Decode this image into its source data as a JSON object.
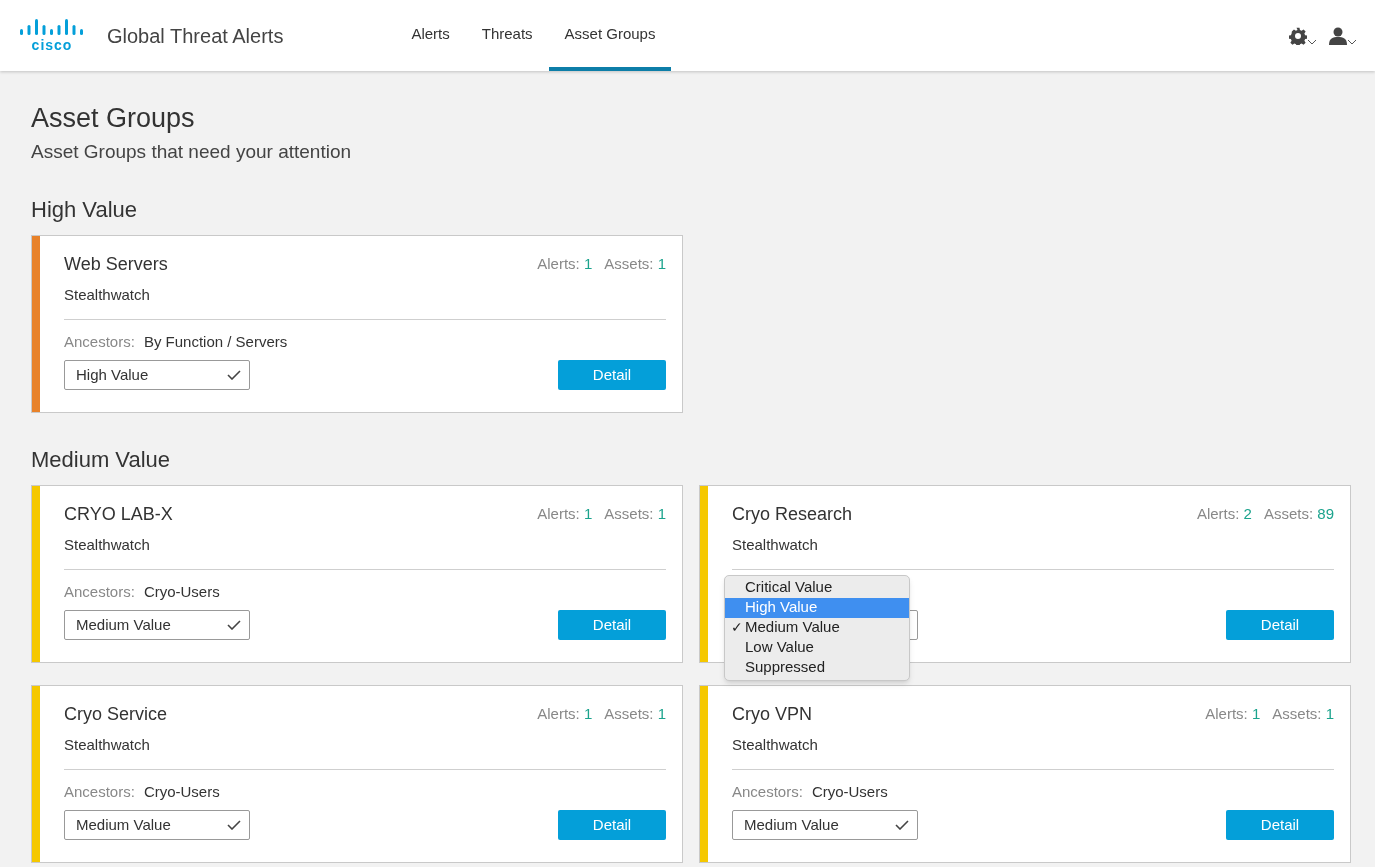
{
  "header": {
    "logo_text": "cisco",
    "app_title": "Global Threat Alerts",
    "nav": [
      {
        "label": "Alerts",
        "selected": false
      },
      {
        "label": "Threats",
        "selected": false
      },
      {
        "label": "Asset Groups",
        "selected": true
      }
    ]
  },
  "page": {
    "title": "Asset Groups",
    "subtitle": "Asset Groups that need your attention"
  },
  "sections": [
    {
      "title": "High Value",
      "cards": [
        {
          "name": "Web Servers",
          "source": "Stealthwatch",
          "alerts_label": "Alerts:",
          "alerts": "1",
          "assets_label": "Assets:",
          "assets": "1",
          "ancestors_label": "Ancestors:",
          "ancestors": "By Function / Servers",
          "color": "#e8822a",
          "value": "High Value",
          "button": "Detail"
        }
      ]
    },
    {
      "title": "Medium Value",
      "cards": [
        {
          "name": "CRYO LAB-X",
          "source": "Stealthwatch",
          "alerts_label": "Alerts:",
          "alerts": "1",
          "assets_label": "Assets:",
          "assets": "1",
          "ancestors_label": "Ancestors:",
          "ancestors": "Cryo-Users",
          "color": "#f5c800",
          "value": "Medium Value",
          "button": "Detail"
        },
        {
          "name": "Cryo Research",
          "source": "Stealthwatch",
          "alerts_label": "Alerts:",
          "alerts": "2",
          "assets_label": "Assets:",
          "assets": "89",
          "color": "#f5c800",
          "button": "Detail",
          "menu": {
            "open": true,
            "check": "✓",
            "options": [
              {
                "label": "Critical Value",
                "selected": false,
                "highlighted": false
              },
              {
                "label": "High Value",
                "selected": false,
                "highlighted": true
              },
              {
                "label": "Medium Value",
                "selected": true,
                "highlighted": false
              },
              {
                "label": "Low Value",
                "selected": false,
                "highlighted": false
              },
              {
                "label": "Suppressed",
                "selected": false,
                "highlighted": false
              }
            ]
          }
        },
        {
          "name": "Cryo Service",
          "source": "Stealthwatch",
          "alerts_label": "Alerts:",
          "alerts": "1",
          "assets_label": "Assets:",
          "assets": "1",
          "ancestors_label": "Ancestors:",
          "ancestors": "Cryo-Users",
          "color": "#f5c800",
          "value": "Medium Value",
          "button": "Detail"
        },
        {
          "name": "Cryo VPN",
          "source": "Stealthwatch",
          "alerts_label": "Alerts:",
          "alerts": "1",
          "assets_label": "Assets:",
          "assets": "1",
          "ancestors_label": "Ancestors:",
          "ancestors": "Cryo-Users",
          "color": "#f5c800",
          "value": "Medium Value",
          "button": "Detail"
        }
      ]
    }
  ]
}
